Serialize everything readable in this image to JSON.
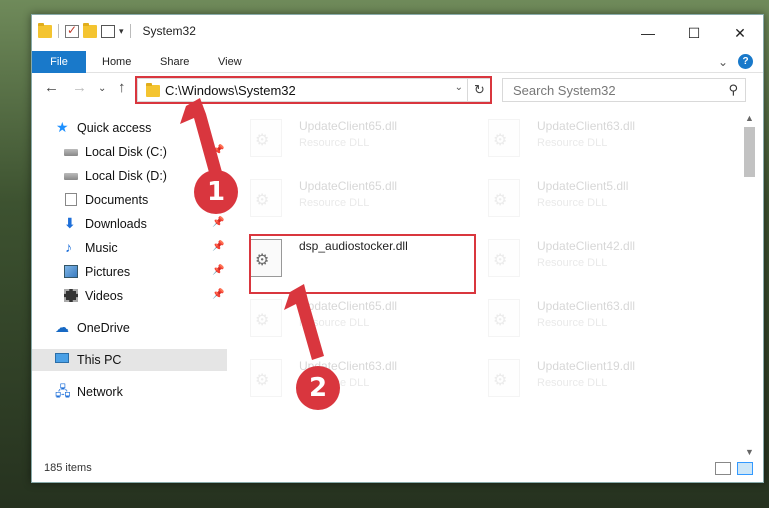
{
  "window": {
    "title": "System32",
    "controls": {
      "minimize": "—",
      "maximize": "☐",
      "close": "✕"
    }
  },
  "ribbon": {
    "tabs": [
      "File",
      "Home",
      "Share",
      "View"
    ],
    "expand_icon": "⌄",
    "help_icon": "?"
  },
  "nav": {
    "back": "←",
    "forward": "→",
    "recent": "⌄",
    "up": "↑"
  },
  "address": {
    "path": "C:\\Windows\\System32",
    "dropdown": "⌄",
    "refresh": "↻"
  },
  "search": {
    "placeholder": "Search System32",
    "icon": "⚲"
  },
  "sidebar": {
    "items": [
      {
        "label": "Quick access",
        "icon": "star-icon",
        "pinned": false
      },
      {
        "label": "Local Disk (C:)",
        "icon": "disk-icon",
        "pinned": true
      },
      {
        "label": "Local Disk (D:)",
        "icon": "disk-icon",
        "pinned": false
      },
      {
        "label": "Documents",
        "icon": "documents-icon",
        "pinned": true
      },
      {
        "label": "Downloads",
        "icon": "download-icon",
        "pinned": true
      },
      {
        "label": "Music",
        "icon": "music-icon",
        "pinned": true
      },
      {
        "label": "Pictures",
        "icon": "pictures-icon",
        "pinned": true
      },
      {
        "label": "Videos",
        "icon": "videos-icon",
        "pinned": true
      },
      {
        "label": "OneDrive",
        "icon": "onedrive-icon",
        "pinned": false
      },
      {
        "label": "This PC",
        "icon": "this-pc-icon",
        "pinned": false,
        "selected": true
      },
      {
        "label": "Network",
        "icon": "network-icon",
        "pinned": false
      }
    ],
    "pin_glyph": "📌"
  },
  "files": [
    {
      "name": "UpdateClient65.dll",
      "desc": "Resource DLL",
      "faded": true
    },
    {
      "name": "UpdateClient63.dll",
      "desc": "Resource DLL",
      "faded": true
    },
    {
      "name": "UpdateClient65.dll",
      "desc": "Resource DLL",
      "faded": true
    },
    {
      "name": "UpdateClient5.dll",
      "desc": "Resource DLL",
      "faded": true
    },
    {
      "name": "dsp_audiostocker.dll",
      "desc": "",
      "faded": false
    },
    {
      "name": "UpdateClient42.dll",
      "desc": "Resource DLL",
      "faded": true
    },
    {
      "name": "UpdateClient65.dll",
      "desc": "Resource DLL",
      "faded": true
    },
    {
      "name": "UpdateClient63.dll",
      "desc": "Resource DLL",
      "faded": true
    },
    {
      "name": "UpdateClient63.dll",
      "desc": "Resource DLL",
      "faded": true
    },
    {
      "name": "UpdateClient19.dll",
      "desc": "Resource DLL",
      "faded": true
    }
  ],
  "status": {
    "item_count": "185 items"
  },
  "annotations": {
    "step1": "1",
    "step2": "2",
    "color": "#d9363e"
  }
}
